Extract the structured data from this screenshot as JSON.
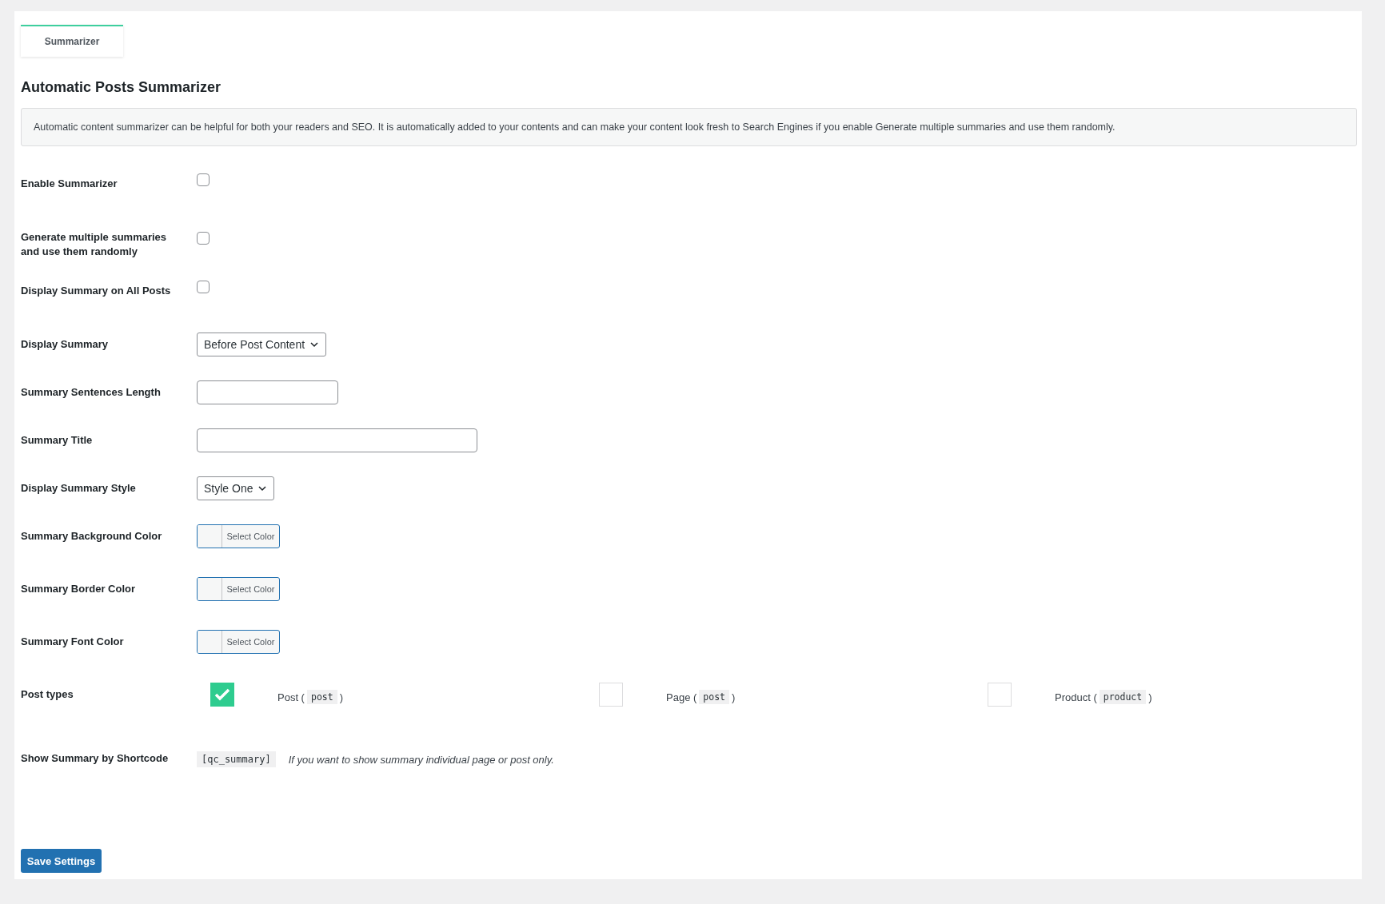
{
  "tabs": [
    {
      "label": "Summarizer",
      "selected": true
    }
  ],
  "heading": "Automatic Posts Summarizer",
  "notice": "Automatic content summarizer can be helpful for both your readers and SEO. It is automatically added to your contents and can make your content look fresh to Search Engines if you enable Generate multiple summaries and use them randomly.",
  "fields": [
    {
      "kind": "checkbox",
      "label": "Enable Summarizer",
      "checked": false
    },
    {
      "kind": "checkbox",
      "label": "Generate multiple summaries and use them randomly",
      "checked": false
    },
    {
      "kind": "checkbox",
      "label": "Display Summary on All Posts",
      "checked": false
    },
    {
      "kind": "select",
      "label": "Display Summary",
      "value": "Before Post Content"
    },
    {
      "kind": "number",
      "label": "Summary Sentences Length"
    },
    {
      "kind": "text",
      "label": "Summary Title"
    },
    {
      "kind": "select",
      "label": "Display Summary Style",
      "value": "Style One"
    },
    {
      "kind": "color",
      "label": "Summary Background Color",
      "button": "Select Color"
    },
    {
      "kind": "color",
      "label": "Summary Border Color",
      "button": "Select Color"
    },
    {
      "kind": "color",
      "label": "Summary Font Color",
      "button": "Select Color"
    },
    {
      "kind": "posttypes",
      "label": "Post types",
      "options": [
        {
          "label": "Post (",
          "code": "post",
          "close": ")",
          "checked": true
        },
        {
          "label": "Page (",
          "code": "post",
          "close": ")",
          "checked": false
        },
        {
          "label": "Product (",
          "code": "product",
          "close": ")",
          "checked": false
        }
      ]
    },
    {
      "kind": "shortcode",
      "label": "Show Summary by Shortcode",
      "code": "[qc_summary]",
      "note": "If you want to show summary individual page or post only."
    }
  ],
  "save_button": "Save Settings"
}
